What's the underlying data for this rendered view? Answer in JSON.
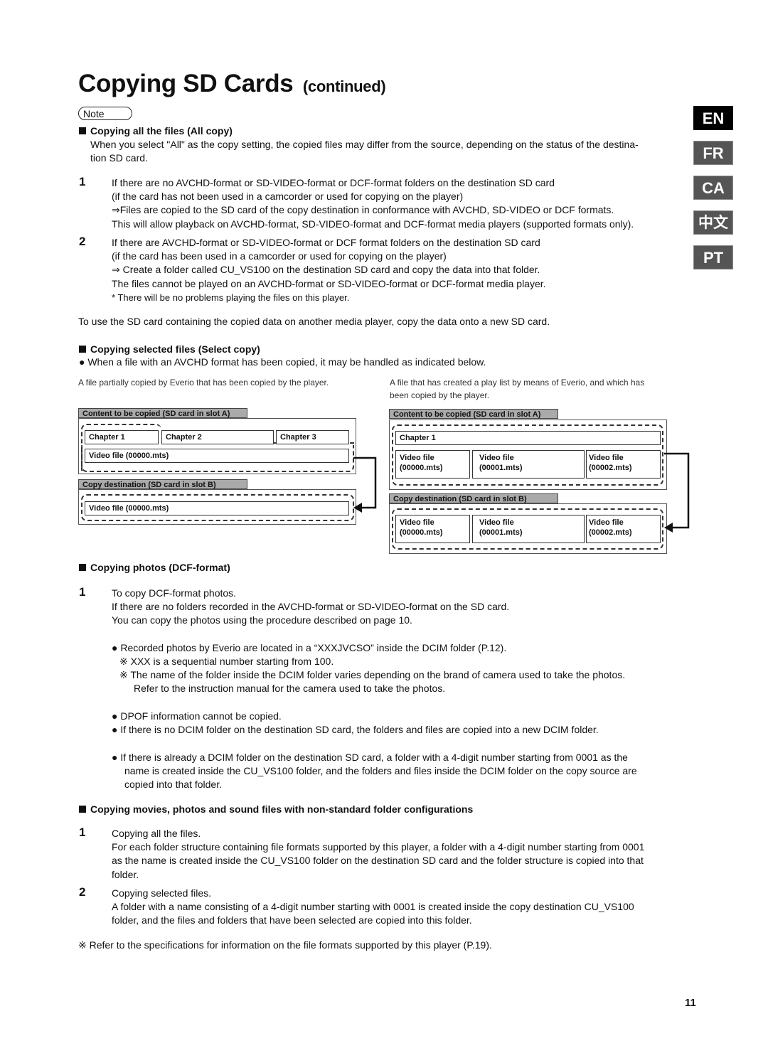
{
  "header": {
    "title": "Copying SD Cards",
    "title_suffix": "(continued)",
    "note_label": "Note"
  },
  "languages": [
    {
      "code": "EN",
      "active": true
    },
    {
      "code": "FR",
      "active": false
    },
    {
      "code": "CA",
      "active": false
    },
    {
      "code": "中文",
      "active": false
    },
    {
      "code": "PT",
      "active": false
    }
  ],
  "section_all_copy": {
    "heading": "Copying all the files (All copy)",
    "intro_line1": "When you select \"All\" as the copy setting, the copied files may differ from the source, depending on the status of the destina-",
    "intro_line2": "tion SD card.",
    "items": [
      {
        "num": "1",
        "lines": [
          "If there are no AVCHD-format or SD-VIDEO-format or DCF-format folders on the destination SD card",
          "(if the card has not been used in a camcorder or used for copying on the player)",
          "⇒Files are copied to the SD card of the copy destination in conformance with AVCHD, SD-VIDEO or DCF formats.",
          "This will allow playback on AVCHD-format, SD-VIDEO-format and DCF-format media players (supported formats only)."
        ]
      },
      {
        "num": "2",
        "lines": [
          "If there are AVCHD-format or SD-VIDEO-format or DCF format folders on the destination SD card",
          "(if the card has been used in a camcorder or used for copying on the player)",
          "⇒ Create a folder called CU_VS100 on the destination SD card and copy the data into that folder.",
          "The files cannot be played on an AVCHD-format or SD-VIDEO-format or DCF-format media player.",
          "* There will be no problems playing the files on this player."
        ]
      }
    ],
    "footer": "To use the SD card containing the copied data on another media player, copy the data onto a new SD card."
  },
  "section_select_copy": {
    "heading": "Copying selected files (Select copy)",
    "bullet": "● When a file with an AVCHD format has been copied, it may be handled as indicated below.",
    "diagram_left": {
      "caption": "A file partially copied by Everio that has been copied by the player.",
      "source_label": "Content to be copied (SD card in slot A)",
      "chapters": [
        "Chapter 1",
        "Chapter 2",
        "Chapter 3"
      ],
      "source_file": "Video file (00000.mts)",
      "dest_label": "Copy destination (SD card in slot B)",
      "dest_file": "Video file (00000.mts)"
    },
    "diagram_right": {
      "caption_line1": "A file that has created a play list by means of Everio, and which has",
      "caption_line2": "been copied by the player.",
      "source_label": "Content to be copied (SD card in slot A)",
      "chapter": "Chapter 1",
      "source_files": [
        {
          "name": "Video file",
          "file": "(00000.mts)"
        },
        {
          "name": "Video file",
          "file": "(00001.mts)"
        },
        {
          "name": "Video file",
          "file": "(00002.mts)"
        }
      ],
      "dest_label": "Copy destination (SD card in slot B)",
      "dest_files": [
        {
          "name": "Video file",
          "file": "(00000.mts)"
        },
        {
          "name": "Video file",
          "file": "(00001.mts)"
        },
        {
          "name": "Video file",
          "file": "(00002.mts)"
        }
      ]
    }
  },
  "section_photos": {
    "heading": "Copying photos (DCF-format)",
    "num": "1",
    "lines": [
      "To copy DCF-format photos.",
      "If there are no folders recorded in the AVCHD-format or SD-VIDEO-format on the SD card.",
      "You can copy the photos using the procedure described on page 10."
    ],
    "bullet1": "● Recorded photos by Everio are located in a “XXXJVCSO” inside the DCIM folder (P.12).",
    "note1": "※ XXX is a sequential number starting from 100.",
    "note2_line1": "※ The name of the folder inside the DCIM folder varies depending on the brand of camera used to take the photos.",
    "note2_line2": "Refer to the instruction manual for the camera used to take the photos.",
    "bullet2": "● DPOF information cannot be copied.",
    "bullet3": "● If there is no DCIM folder on the destination SD card, the folders and files are copied into a new DCIM folder.",
    "bullet4_line1": "● If there is already a DCIM folder on the destination SD card, a folder with a 4-digit number starting from 0001 as the",
    "bullet4_line2": "name is created inside the CU_VS100 folder, and the  folders and files inside the DCIM folder on the copy source are",
    "bullet4_line3": "copied into that folder."
  },
  "section_nonstandard": {
    "heading": "Copying movies, photos and sound files with non-standard folder configurations",
    "items": [
      {
        "num": "1",
        "lines": [
          "Copying all the files.",
          "For each folder structure containing file formats supported by this player, a folder with a 4-digit number starting from 0001",
          "as the name  is created inside the CU_VS100 folder on the destination SD card and the folder structure is copied into that",
          "folder."
        ]
      },
      {
        "num": "2",
        "lines": [
          "Copying selected files.",
          "A folder with a name consisting of a 4-digit number starting with 0001 is created inside the copy destination CU_VS100",
          "folder, and the files and folders that have been selected are copied into this folder."
        ]
      }
    ],
    "footnote": "※ Refer to the specifications for information on the file formats supported by this player (P.19)."
  },
  "footer": {
    "page_number": "11"
  }
}
